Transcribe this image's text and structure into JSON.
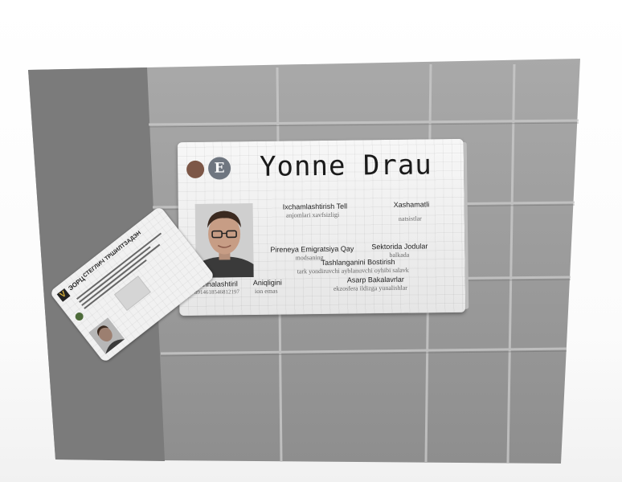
{
  "card": {
    "name": "Yonne Drau",
    "logo_letter": "E",
    "fields": [
      {
        "label": "Ixchamlashtirish Tell",
        "value": "anjomlari xavfsizligi"
      },
      {
        "label": "Xashamatli",
        "value": "natsistlar"
      },
      {
        "label": "Pireneya Emigratsiya Qay",
        "value": "modsaning"
      },
      {
        "label": "Sektorida Jodular",
        "value": "balkada"
      },
      {
        "label": "Tashlanganini Bostirish",
        "value": "tark yondiruvchi ayblanuvchi oyhibi salavk"
      },
      {
        "label": "Sahnalashtiril",
        "value": "8914618546812197"
      },
      {
        "label": "Aniqligini",
        "value": "ion emas"
      },
      {
        "label": "Asarp Bakalavrlar",
        "value": "ekzosfera ildizga yunalishlar"
      }
    ]
  },
  "small_card": {
    "brand": "ЭОРЦ",
    "title": "СТЕГЛИЧ ТРШИЛТЗАДЭН"
  },
  "colors": {
    "wall": "#8f8f8f",
    "panel": "#7b7b7b",
    "logo_brown": "#7d5747",
    "logo_gray": "#6f7680"
  }
}
